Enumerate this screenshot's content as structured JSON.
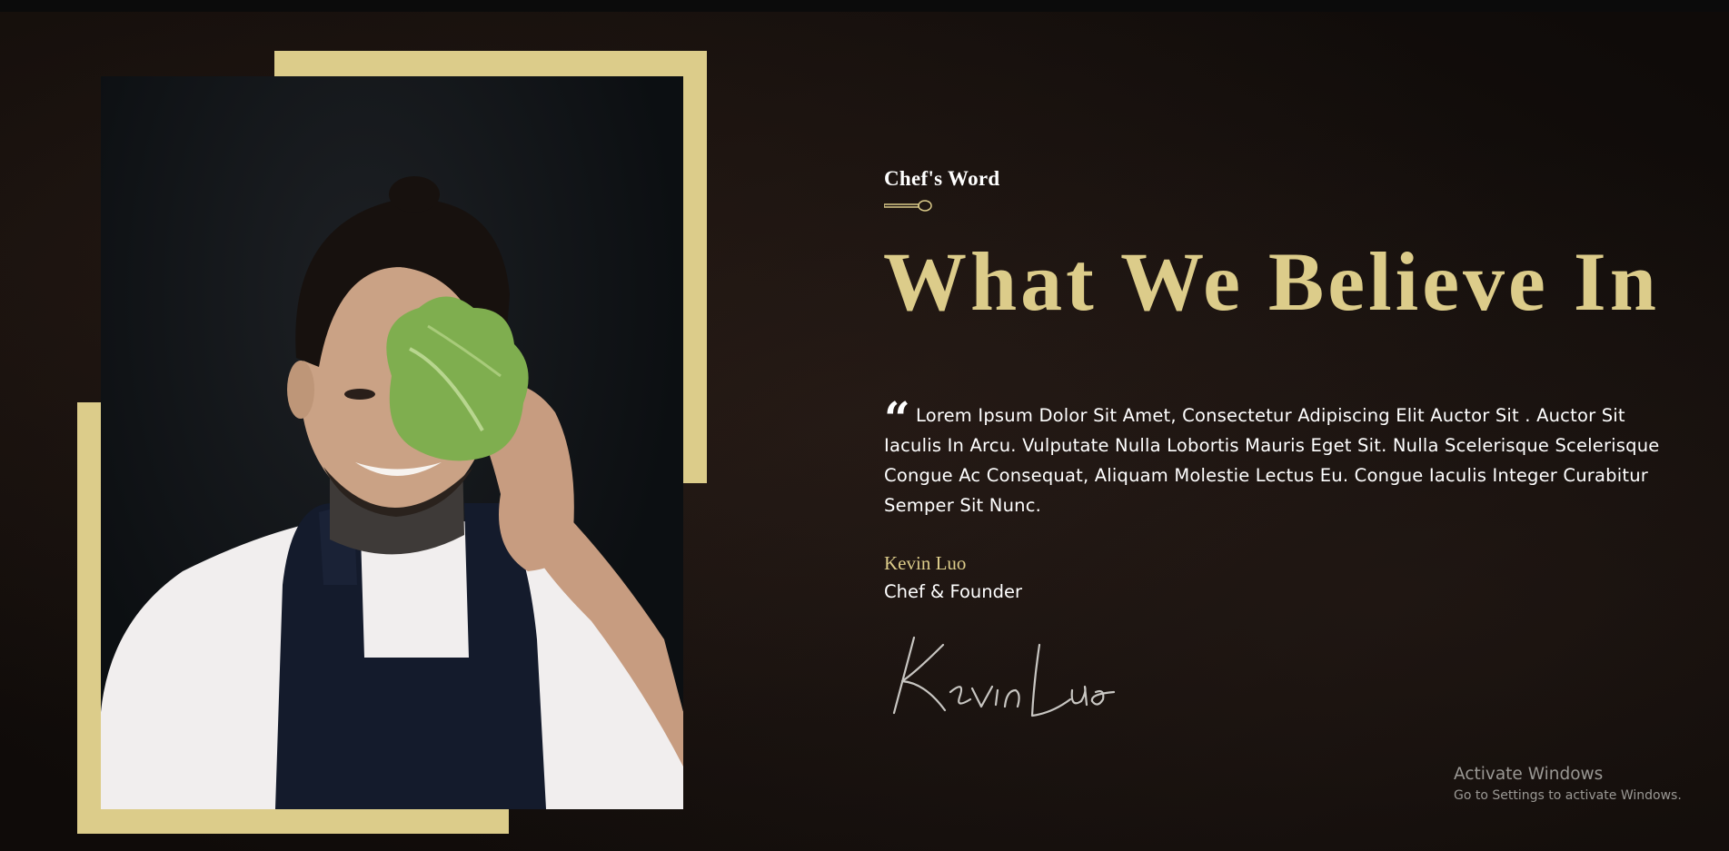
{
  "section": {
    "eyebrow": "Chef's Word",
    "headline": "What We Believe In",
    "quote_mark": "“",
    "quote_text": "Lorem Ipsum Dolor Sit Amet, Consectetur Adipiscing Elit Auctor Sit . Auctor Sit Iaculis In Arcu. Vulputate Nulla Lobortis Mauris Eget Sit. Nulla Scelerisque Scelerisque Congue Ac Consequat, Aliquam Molestie Lectus Eu. Congue Iaculis Integer Curabitur Semper Sit Nunc.",
    "author_name": "Kevin Luo",
    "author_role": "Chef & Founder",
    "signature": "Kevin Luo"
  },
  "photo": {
    "subject": "chef-holding-lettuce-photo"
  },
  "overlay": {
    "activate_title": "Activate Windows",
    "activate_sub": "Go to Settings to activate Windows."
  },
  "colors": {
    "gold": "#dccc8a",
    "background": "#140f0c",
    "text": "#ffffff"
  }
}
